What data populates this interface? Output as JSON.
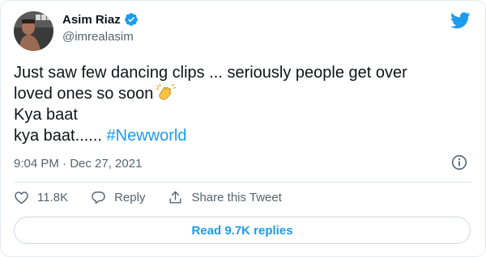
{
  "author": {
    "display_name": "Asim Riaz",
    "handle": "@imrealasim",
    "verified": true
  },
  "tweet": {
    "line1": "Just saw few dancing clips ... seriously people get over",
    "line2": "loved ones so soon",
    "line3": "Kya baat",
    "line4_text": "kya baat...... ",
    "hashtag": "#Newworld",
    "emoji": "clapping-hands-emoji",
    "timestamp": "9:04 PM · Dec 27, 2021"
  },
  "actions": {
    "likes": "11.8K",
    "reply_label": "Reply",
    "share_label": "Share this Tweet"
  },
  "footer": {
    "read_replies_label": "Read 9.7K replies"
  },
  "colors": {
    "accent": "#1d9bf0",
    "text": "#0f1419",
    "muted": "#536471",
    "border": "#cfd9de"
  },
  "icons": [
    "twitter-bird-icon",
    "verified-badge-icon",
    "info-icon",
    "heart-icon",
    "reply-icon",
    "share-icon"
  ]
}
